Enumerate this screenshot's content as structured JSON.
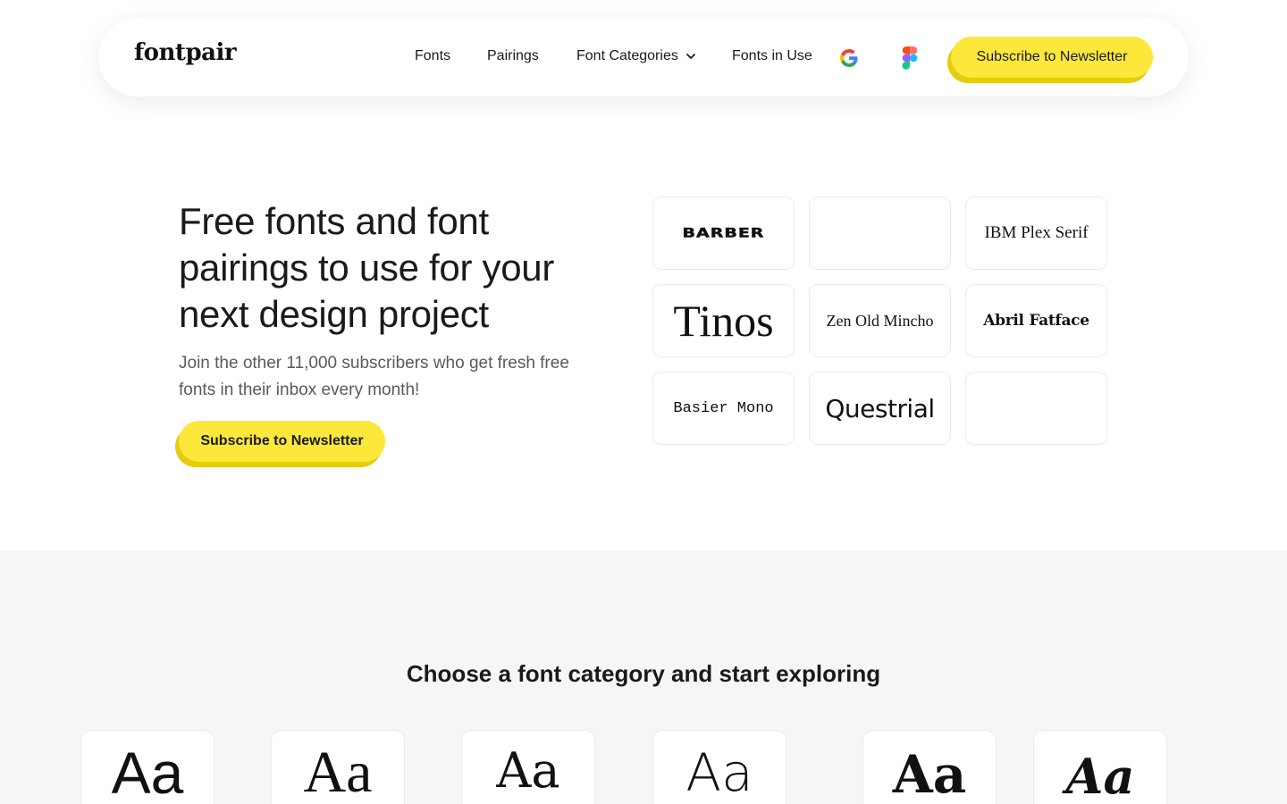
{
  "nav": {
    "logo": "fontpair",
    "links": [
      "Fonts",
      "Pairings",
      "Font Categories",
      "Fonts in Use"
    ],
    "google_icon": "google-icon",
    "figma_icon": "figma-icon",
    "subscribe_label": "Subscribe to Newsletter"
  },
  "hero": {
    "title": "Free fonts and font pairings to use for your next design project",
    "subtitle": "Join the other 11,000 subscribers who get fresh free fonts in their inbox every month!",
    "button_label": "Subscribe to Newsletter",
    "tiles": [
      "BARBER",
      "",
      "IBM Plex Serif",
      "Tinos",
      "Zen Old Mincho",
      "Abril Fatface",
      "Basier Mono",
      "Questrial",
      ""
    ]
  },
  "categories": {
    "title": "Choose a font category and start exploring",
    "cards": [
      "Aa",
      "Aa",
      "Aa",
      "Aa",
      "Aa",
      "Aa"
    ]
  },
  "colors": {
    "accent": "#fbe83a",
    "accent_shadow": "#e4cc10",
    "section_bg": "#f6f6f6"
  }
}
